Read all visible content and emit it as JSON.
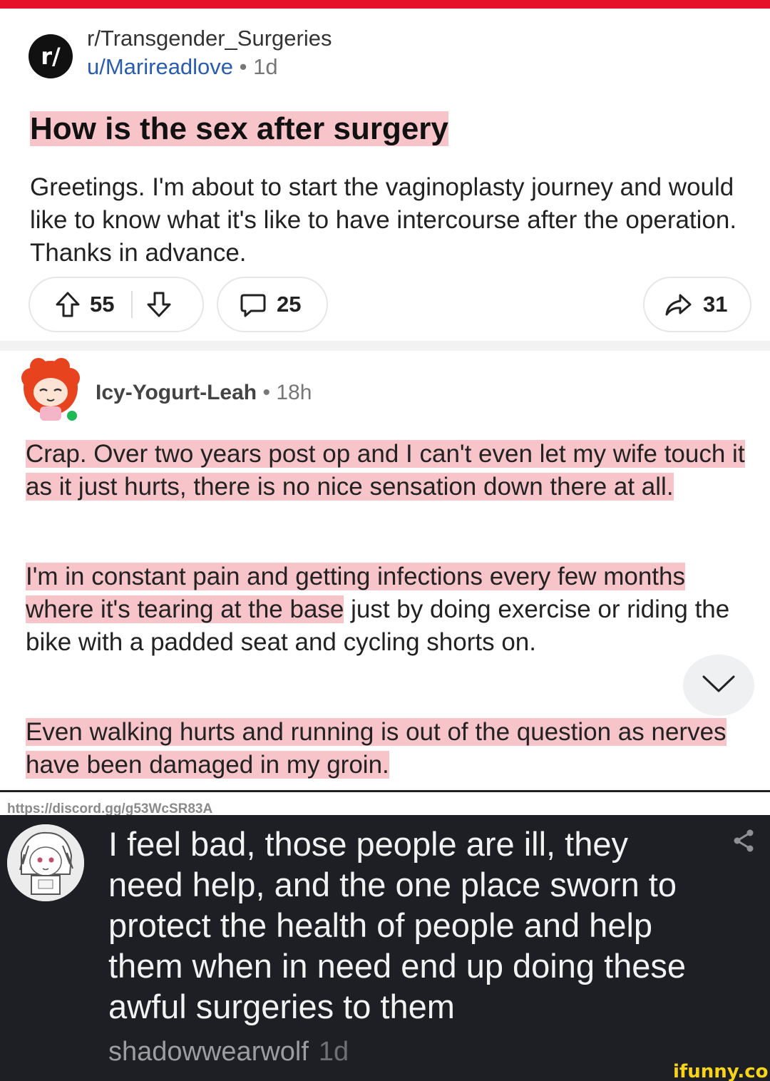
{
  "post": {
    "subreddit": "r/Transgender_Surgeries",
    "sub_icon_text": "r/",
    "author": "u/Marireadlove",
    "separator": " • ",
    "time": "1d",
    "title": "How is the sex after surgery",
    "body": "Greetings. I'm about to start the vaginoplasty journey and would like to know what it's like to have intercourse after the operation. Thanks in advance.",
    "upvotes": "55",
    "comments": "25",
    "shares": "31"
  },
  "comment": {
    "author": "Icy-Yogurt-Leah",
    "separator": " • ",
    "time": "18h",
    "para1": "Crap. Over two years post op and I can't even let my wife touch it as it just hurts, there is no nice sensation down there at all.",
    "para2_highlight": "I'm in constant pain and getting infections every few months where it's tearing at the base",
    "para2_rest": " just by doing exercise or riding the bike with a padded seat and cycling shorts on.",
    "para3": "Even walking hurts and running is out of the question as nerves have been damaged in my groin."
  },
  "source_url": "https://discord.gg/g53WcSR83A",
  "reply": {
    "text": "I feel bad, those people are ill, they need help, and the one place sworn to protect the health of people and help them when in need end up doing these awful surgeries to them",
    "username": "shadowwearwolf",
    "time": "1d"
  },
  "watermark": "ifunny.co",
  "colors": {
    "top_bar": "#e5122a",
    "highlight": "#f6c4c9",
    "dark_bg": "#1d1f25",
    "watermark": "#f7d417"
  }
}
